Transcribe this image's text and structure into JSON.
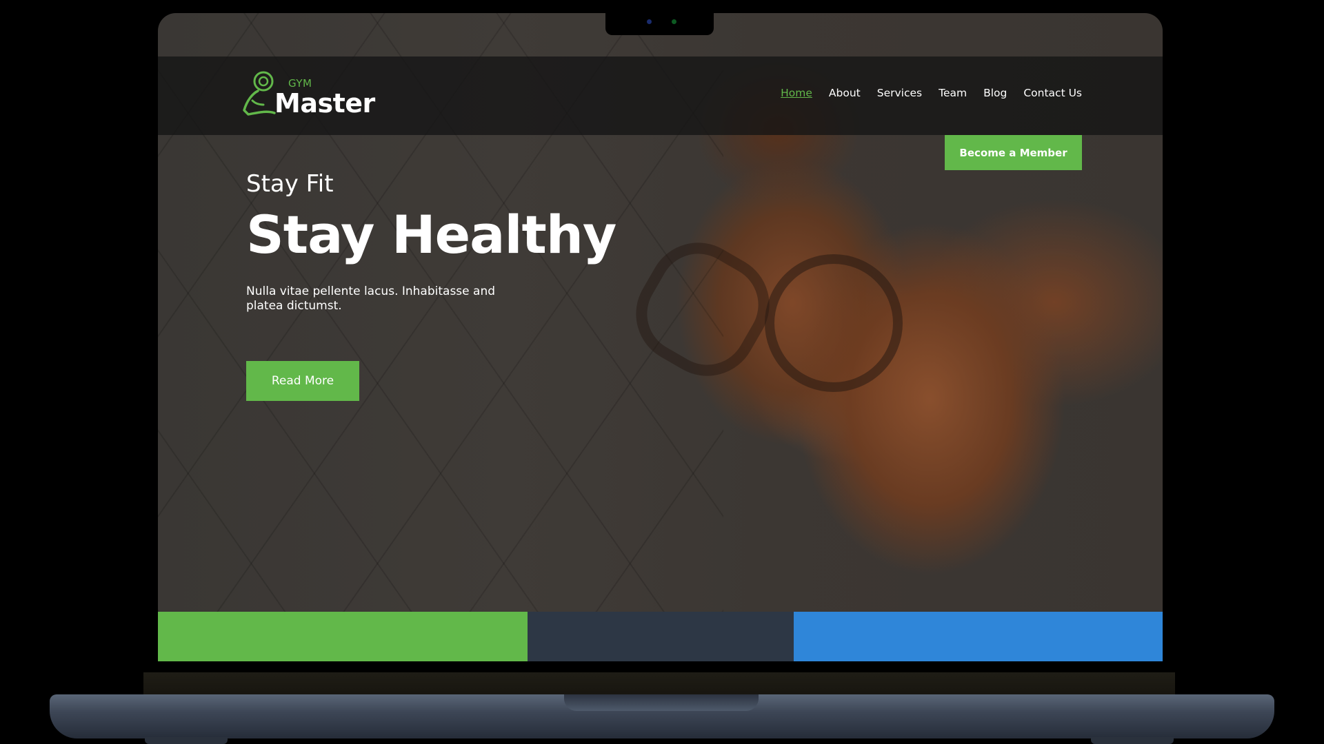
{
  "brand": {
    "small": "GYM",
    "large": "Master",
    "icon": "flexed-arm-dumbbell-icon",
    "accent_color": "#62b84a"
  },
  "nav": {
    "items": [
      {
        "label": "Home",
        "active": true
      },
      {
        "label": "About",
        "active": false
      },
      {
        "label": "Services",
        "active": false
      },
      {
        "label": "Team",
        "active": false
      },
      {
        "label": "Blog",
        "active": false
      },
      {
        "label": "Contact Us",
        "active": false
      }
    ]
  },
  "cta": {
    "label": "Become a Member"
  },
  "hero": {
    "kicker": "Stay Fit",
    "title": "Stay Healthy",
    "description": "Nulla vitae pellente lacus. Inhabitasse and platea dictumst.",
    "button_label": "Read More"
  },
  "color_bars": {
    "green": "#62b84a",
    "dark": "#2d3745",
    "blue": "#2f86d9"
  }
}
